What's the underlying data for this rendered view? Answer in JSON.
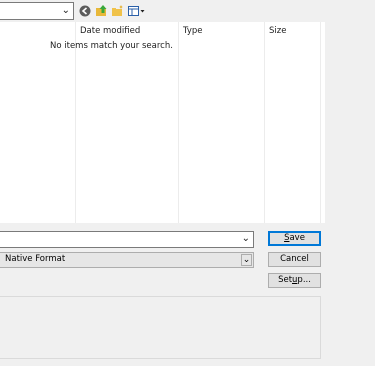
{
  "list": {
    "columns": [
      "Date modified",
      "Type",
      "Size"
    ],
    "empty_message": "No items match your search."
  },
  "filename": {
    "value": ""
  },
  "filetype": {
    "value": "Native Format"
  },
  "buttons": {
    "save": [
      "S",
      "ave"
    ],
    "cancel": "Cancel",
    "setup": [
      "Set",
      "u",
      "p..."
    ]
  },
  "icons": {
    "back": "back-arrow-icon",
    "up": "up-folder-icon",
    "new_folder": "new-folder-icon",
    "view": "view-menu-icon"
  }
}
